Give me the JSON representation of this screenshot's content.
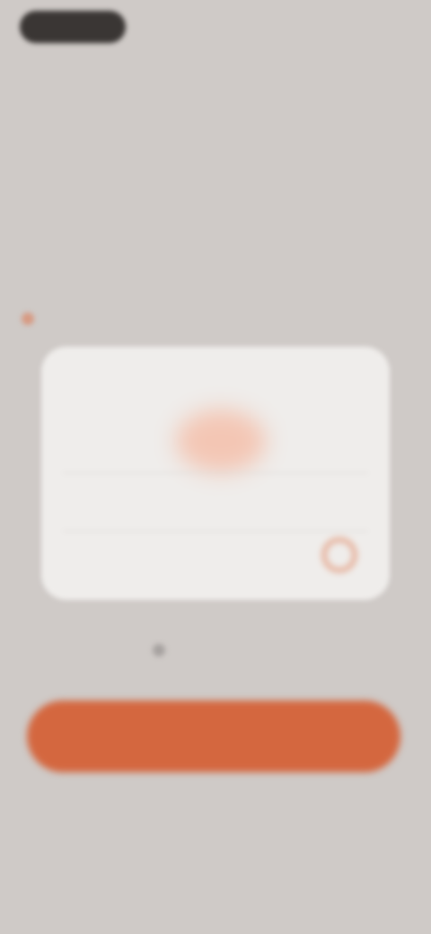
{
  "status_bar": {
    "left_pill": "",
    "right_text": ""
  },
  "nav": {
    "title": ""
  },
  "main": {
    "heading": "",
    "subtext": ""
  },
  "dialog": {
    "title": "",
    "message": "",
    "primary_button": "",
    "secondary_button": ""
  },
  "helper": {
    "text": ""
  },
  "cta": {
    "label": ""
  },
  "colors": {
    "background": "#cfcac7",
    "accent": "#d4673f",
    "dialog": "#efedeb",
    "text_dark": "#4a4543"
  }
}
